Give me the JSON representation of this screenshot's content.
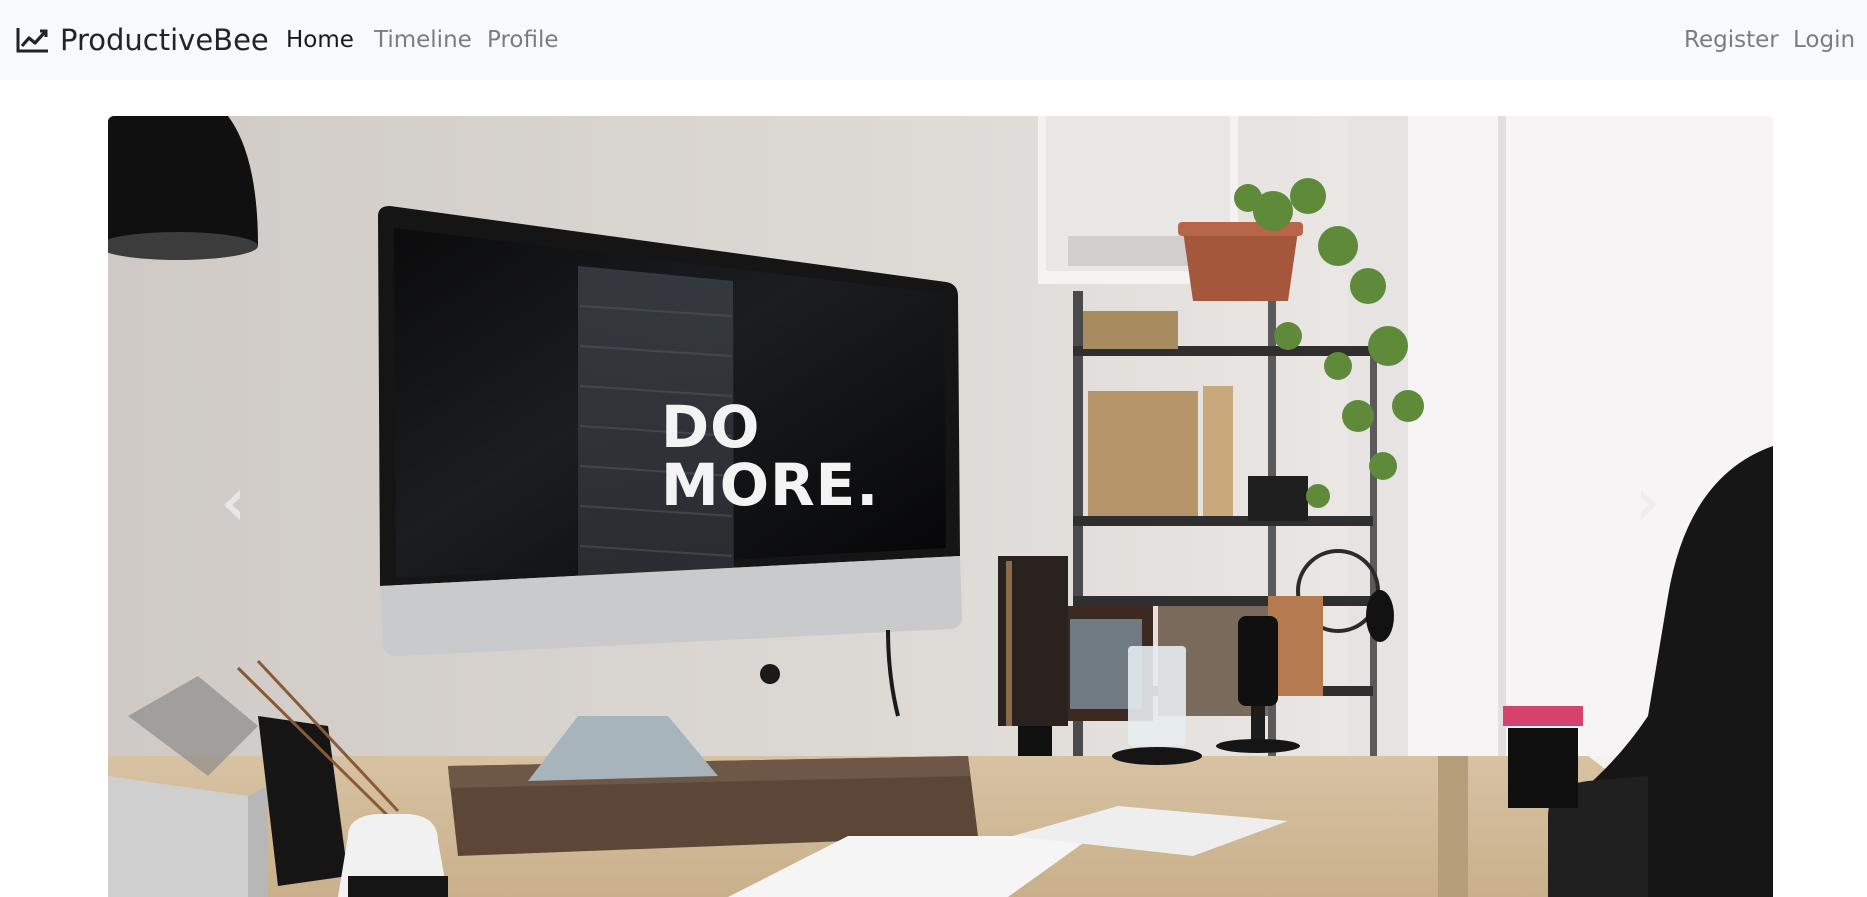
{
  "navbar": {
    "brand_icon": "trending-up-icon",
    "brand": "ProductiveBee",
    "links": [
      "Home",
      "Timeline",
      "Profile"
    ],
    "active_link": "Home",
    "right_links": [
      "Register",
      "Login"
    ]
  },
  "carousel": {
    "slide": {
      "screen_text_line1": "DO",
      "screen_text_line2": "MORE.",
      "description": "desk workspace with monitor"
    },
    "prev_icon": "chevron-left-icon",
    "next_icon": "chevron-right-icon"
  },
  "colors": {
    "navbar_bg": "#f8f9fa",
    "nav_active": "#212529",
    "nav_muted": "#7f8082"
  }
}
